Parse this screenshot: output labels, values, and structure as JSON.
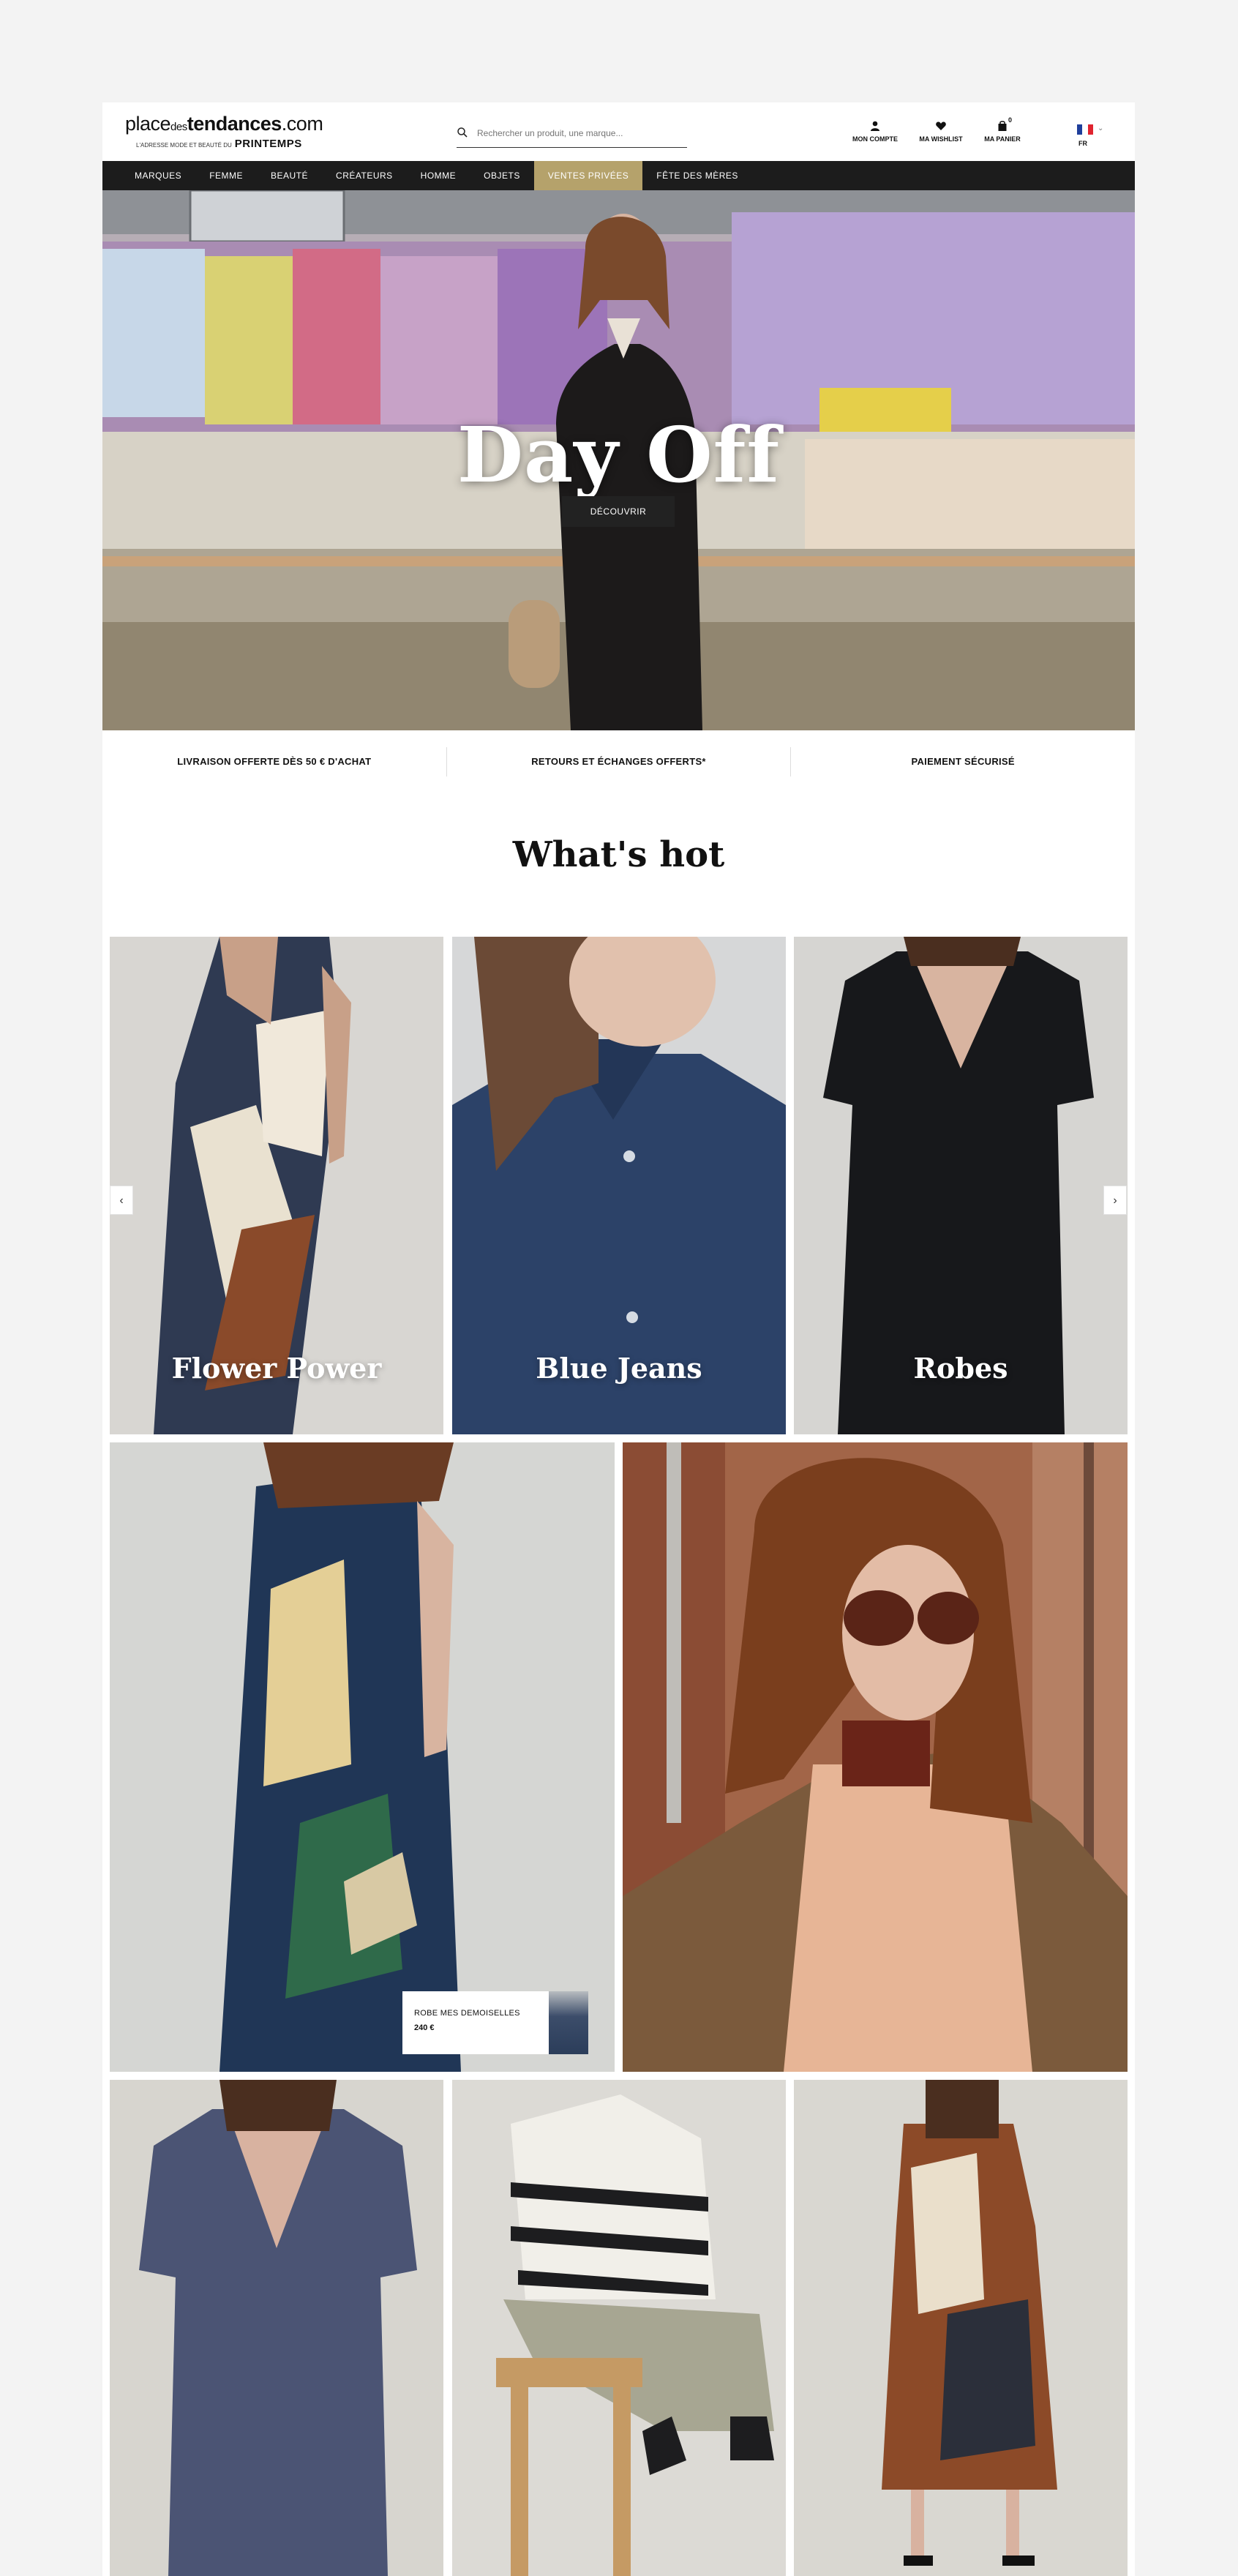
{
  "header": {
    "logo": {
      "part1": "place",
      "part2": "des",
      "part3": "tendances",
      "part4": ".com",
      "tagline": "L'ADRESSE MODE ET BEAUTÉ DU",
      "partner": "PRINTEMPS"
    },
    "search": {
      "placeholder": "Rechercher un produit, une marque..."
    },
    "account_label": "MON COMPTE",
    "wishlist_label": "MA WISHLIST",
    "cart_label": "MA PANIER",
    "cart_count": "0",
    "language": "FR"
  },
  "nav": {
    "items": [
      "MARQUES",
      "FEMME",
      "BEAUTÉ",
      "CRÉATEURS",
      "HOMME",
      "OBJETS",
      "VENTES PRIVÉES",
      "FÊTE DES MÈRES"
    ],
    "active_index": 6
  },
  "hero": {
    "title": "Day Off",
    "button": "DÉCOUVRIR"
  },
  "reassurance": [
    "LIVRAISON OFFERTE DÈS 50 € D'ACHAT",
    "RETOURS ET ÉCHANGES OFFERTS*",
    "PAIEMENT SÉCURISÉ"
  ],
  "whats_hot": {
    "title": "What's hot",
    "tiles": [
      "Flower Power",
      "Blue Jeans",
      "Robes"
    ],
    "prev_arrow": "‹",
    "next_arrow": "›"
  },
  "featured_product": {
    "name": "ROBE MES DEMOISELLES",
    "price": "240 €"
  },
  "colors": {
    "nav_bg": "#1c1c1c",
    "nav_active": "#b5a26b",
    "page_bg": "#f3f3f3"
  }
}
